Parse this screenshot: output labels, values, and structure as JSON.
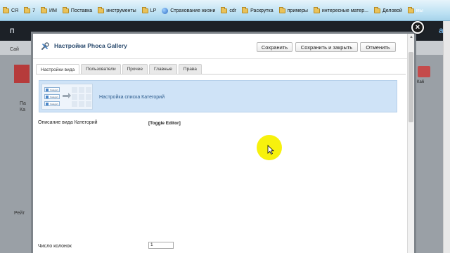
{
  "bookmarks": {
    "items": [
      "СЯ",
      "7",
      "ИМ",
      "Поставка",
      "инструменты",
      "LP",
      "Страхование жизни",
      "cdr",
      "Раскрутка",
      "примеры",
      "интересные матер...",
      "Деловой",
      "мы"
    ]
  },
  "background_page": {
    "header_text": "П",
    "header_right_text": "al",
    "strip_text": "Сай",
    "left_text_1": "Па",
    "left_text_2": "Ка",
    "left_text_3": "Рейт",
    "right_label": "Кa6"
  },
  "modal": {
    "title": "Настройки Phoca Gallery",
    "buttons": {
      "save": "Сохранить",
      "save_close": "Сохранить и закрыть",
      "cancel": "Отменить"
    },
    "close_symbol": "×",
    "tabs": [
      {
        "label": "Настройки вида",
        "active": true
      },
      {
        "label": "Пользователи",
        "active": false
      },
      {
        "label": "Прочее",
        "active": false
      },
      {
        "label": "Главные",
        "active": false
      },
      {
        "label": "Права",
        "active": false
      }
    ],
    "info": {
      "text": "Настройка списка Категорий",
      "thumb_labels": [
        "Category",
        "Category",
        "Category"
      ]
    },
    "fields": {
      "description_label": "Описание вида Категорий",
      "toggle_editor": "[Toggle Editor]",
      "columns_label": "Число колонок",
      "columns_value": "1"
    }
  },
  "colors": {
    "info_bg": "#cfe3f7",
    "title_color": "#2b4b6e",
    "cursor_highlight": "#f7f000"
  }
}
